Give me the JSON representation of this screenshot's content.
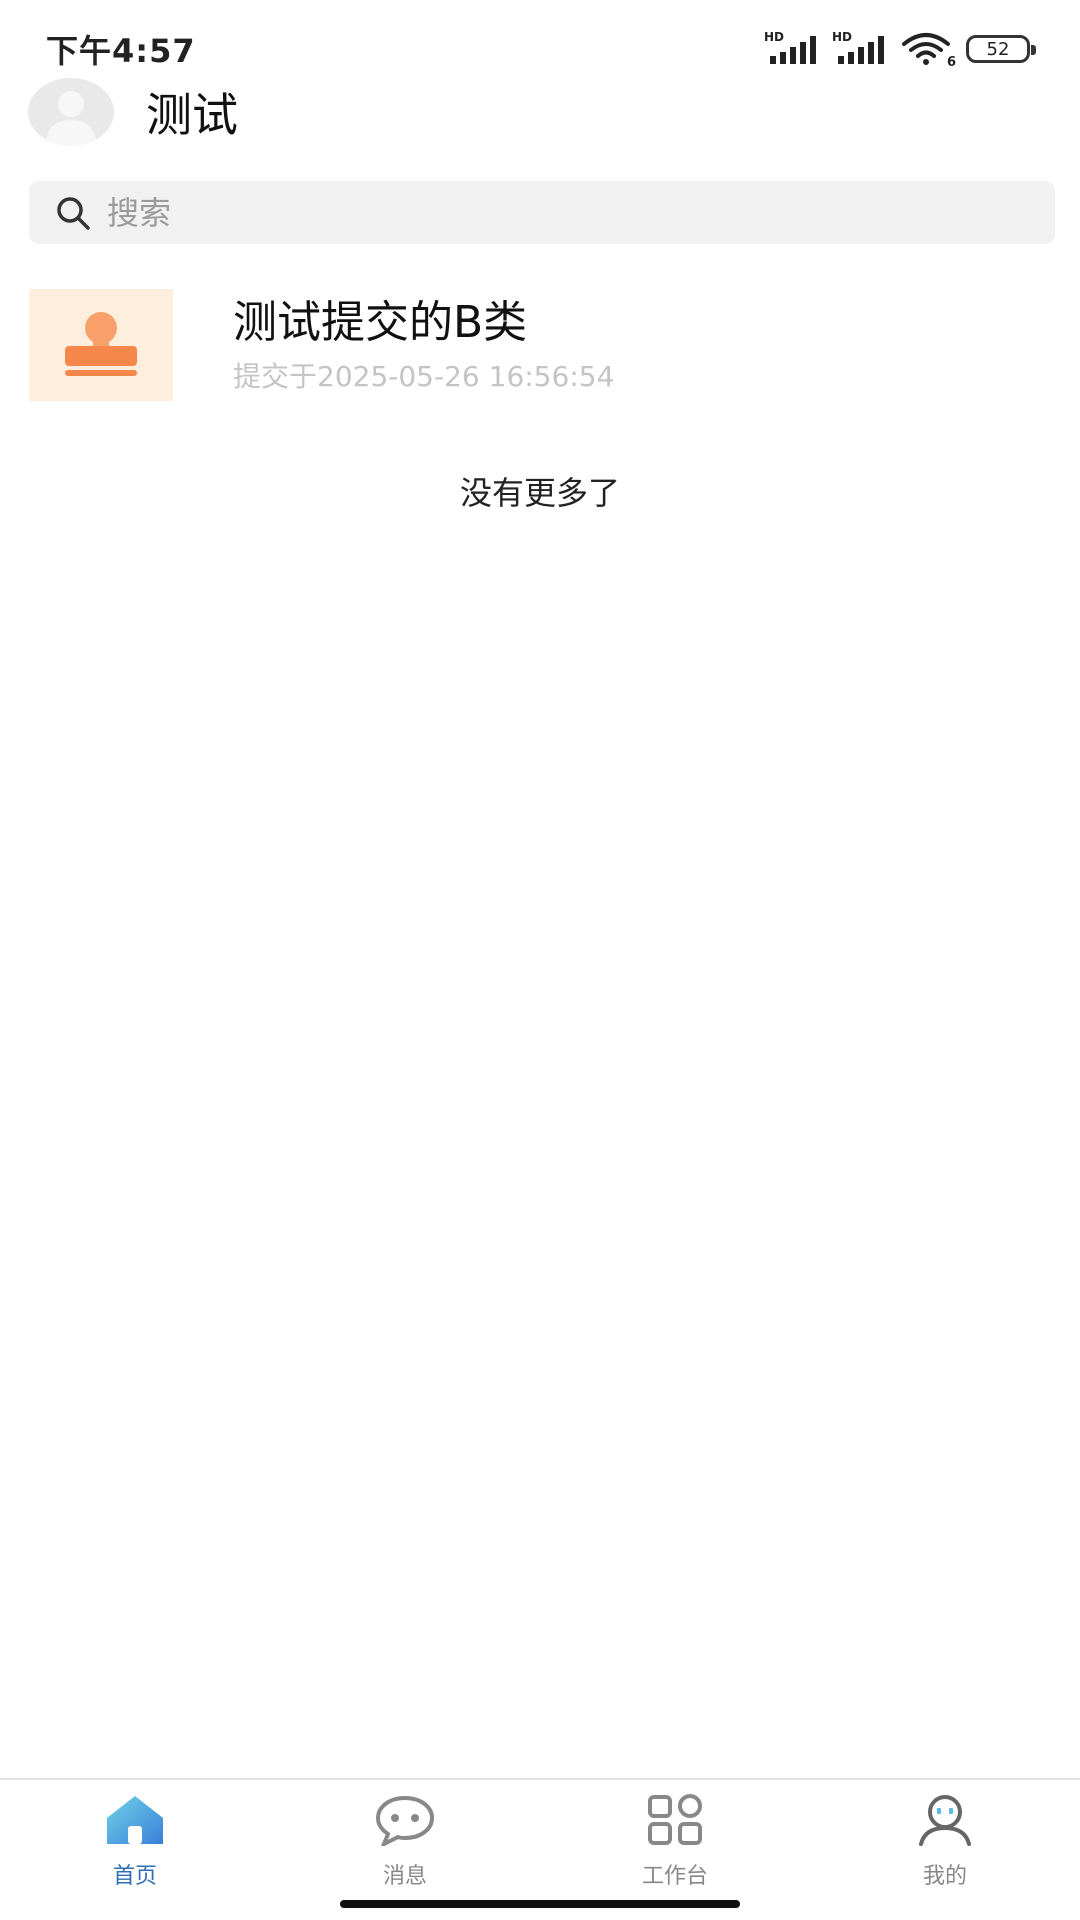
{
  "status_bar": {
    "time": "下午4:57",
    "signal1_label": "HD",
    "signal2_label": "HD",
    "wifi_label": "6",
    "battery": "52"
  },
  "header": {
    "title": "测试"
  },
  "search": {
    "placeholder": "搜索"
  },
  "list": {
    "items": [
      {
        "title": "测试提交的B类",
        "subtitle": "提交于2025-05-26 16:56:54",
        "icon": "stamp-icon"
      }
    ],
    "end_text": "没有更多了"
  },
  "bottom_nav": {
    "items": [
      {
        "label": "首页",
        "icon": "home-icon",
        "active": true
      },
      {
        "label": "消息",
        "icon": "message-icon",
        "active": false
      },
      {
        "label": "工作台",
        "icon": "workbench-icon",
        "active": false
      },
      {
        "label": "我的",
        "icon": "profile-icon",
        "active": false
      }
    ]
  },
  "colors": {
    "accent": "#2f6fb0",
    "stamp": "#f5874a",
    "thumb_bg": "#fdeedd",
    "search_bg": "#f1f1f1"
  }
}
